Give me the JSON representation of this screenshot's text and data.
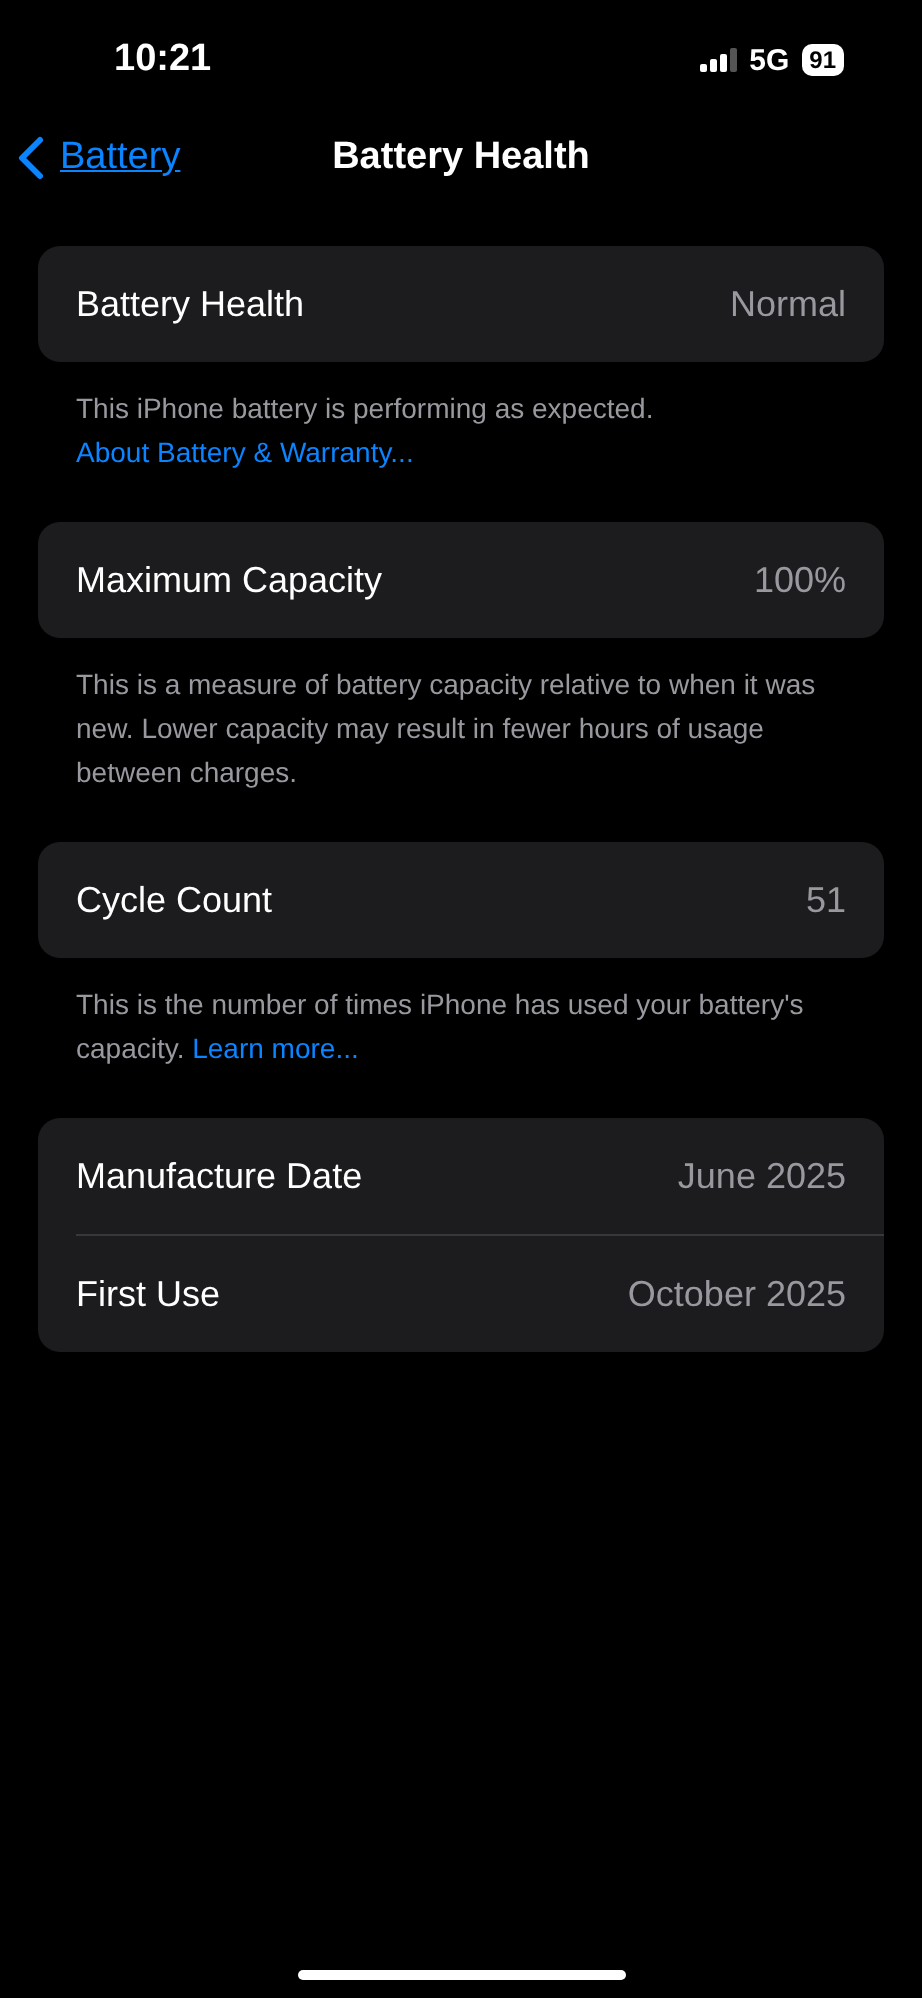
{
  "status_bar": {
    "time": "10:21",
    "network": "5G",
    "battery": "91"
  },
  "nav": {
    "back": "Battery",
    "title": "Battery Health"
  },
  "sections": [
    {
      "rows": [
        {
          "label": "Battery Health",
          "value": "Normal"
        }
      ],
      "footer": {
        "text": "This iPhone battery is performing as expected.",
        "link": "About Battery & Warranty..."
      }
    },
    {
      "rows": [
        {
          "label": "Maximum Capacity",
          "value": "100%"
        }
      ],
      "footer": {
        "text": "This is a measure of battery capacity relative to when it was new. Lower capacity may result in fewer hours of usage between charges."
      }
    },
    {
      "rows": [
        {
          "label": "Cycle Count",
          "value": "51"
        }
      ],
      "footer": {
        "text": "This is the number of times iPhone has used your battery's capacity.",
        "link": "Learn more..."
      }
    },
    {
      "rows": [
        {
          "label": "Manufacture Date",
          "value": "June 2025"
        },
        {
          "label": "First Use",
          "value": "October 2025"
        }
      ]
    }
  ]
}
